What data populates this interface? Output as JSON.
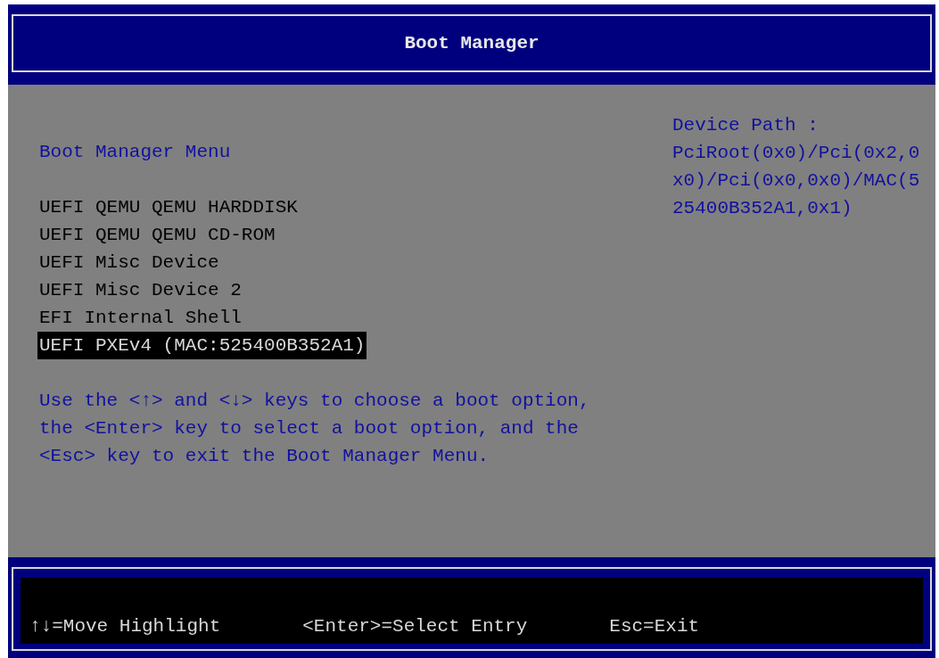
{
  "window": {
    "title": "Boot Manager"
  },
  "menu": {
    "title": "Boot Manager Menu",
    "items": [
      {
        "label": "UEFI QEMU QEMU HARDDISK",
        "selected": false
      },
      {
        "label": "UEFI QEMU QEMU CD-ROM",
        "selected": false
      },
      {
        "label": "UEFI Misc Device",
        "selected": false
      },
      {
        "label": "UEFI Misc Device 2",
        "selected": false
      },
      {
        "label": "EFI Internal Shell",
        "selected": false
      },
      {
        "label": "UEFI PXEv4 (MAC:525400B352A1)",
        "selected": true
      }
    ],
    "help": "Use the <↑> and <↓> keys to choose a boot option, the <Enter> key to select a boot option, and the <Esc> key to exit the Boot Manager Menu."
  },
  "device_path": {
    "label": "Device Path :",
    "value": "PciRoot(0x0)/Pci(0x2,0x0)/Pci(0x0,0x0)/MAC(525400B352A1,0x1)"
  },
  "status_bar": [
    "↑↓=Move Highlight",
    "<Enter>=Select Entry",
    "Esc=Exit"
  ]
}
